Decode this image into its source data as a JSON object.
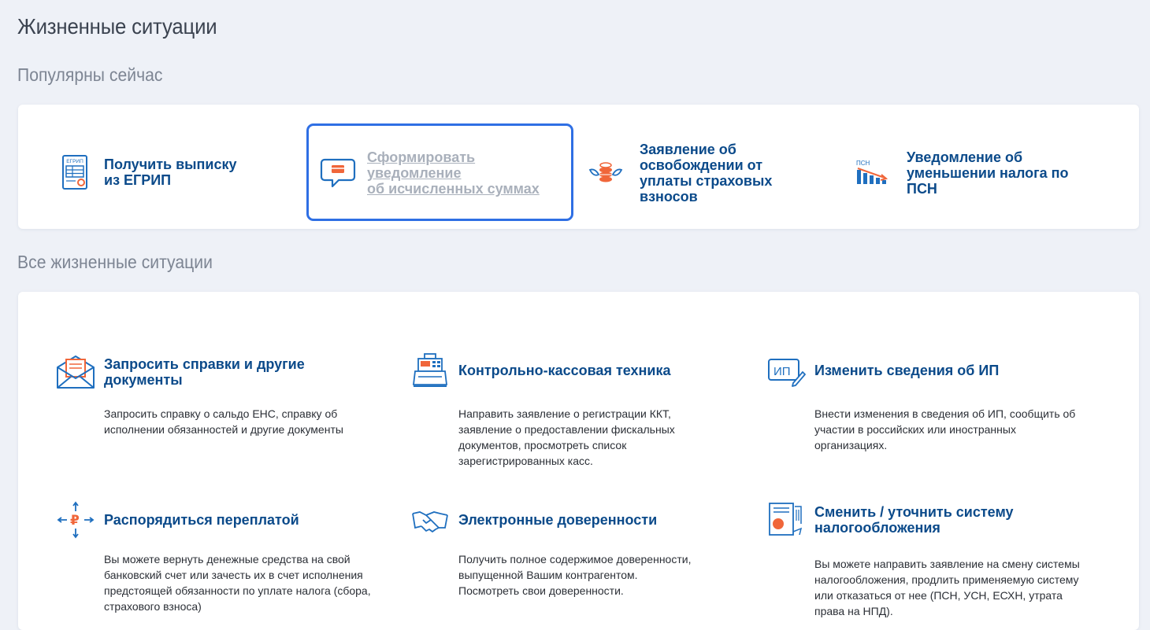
{
  "page": {
    "title": "Жизненные ситуации"
  },
  "sections": {
    "popular": "Популярны сейчас",
    "all": "Все жизненные ситуации"
  },
  "popular": [
    {
      "label": "Получить выписку\nиз ЕГРИП",
      "icon": "egrip-document-icon",
      "icon_text": "ЕГРИП"
    },
    {
      "label": "Сформировать\nуведомление\nоб исчисленных суммах",
      "icon": "chat-notification-icon"
    },
    {
      "label": "Заявление об\nосвобождении от\nуплаты страховых\nвзносов",
      "icon": "coins-wings-icon"
    },
    {
      "label": "Уведомление об\nуменьшении налога по\nПСН",
      "icon": "psn-chart-icon",
      "icon_text": "ПСН"
    }
  ],
  "situations": [
    {
      "title": "Запросить справки и другие\nдокументы",
      "desc": "Запросить справку о сальдо ЕНС, справку об\nисполнении обязанностей и другие документы",
      "icon": "envelope-document-icon"
    },
    {
      "title": "Контрольно-кассовая техника",
      "desc": "Направить заявление о регистрации ККТ,\nзаявление о предоставлении фискальных\nдокументов, просмотреть список\nзарегистрированных касс.",
      "icon": "cash-register-icon"
    },
    {
      "title": "Изменить сведения об ИП",
      "desc": "Внести изменения в сведения об ИП, сообщить об\nучастии в российских или иностранных\nорганизациях.",
      "icon": "ip-edit-icon",
      "icon_text": "ИП"
    },
    {
      "title": "Распорядиться переплатой",
      "desc": "Вы можете вернуть денежные средства на свой\nбанковский счет или зачесть их в счет исполнения\nпредстоящей обязанности по уплате налога (сбора,\nстрахового взноса)",
      "icon": "ruble-arrows-icon",
      "icon_text": "₽"
    },
    {
      "title": "Электронные доверенности",
      "desc": "Получить полное содержимое доверенности,\nвыпущенной Вашим контрагентом.\nПосмотреть свои доверенности.",
      "icon": "handshake-icon"
    },
    {
      "title": "Сменить / уточнить систему\nналогообложения",
      "desc": "Вы можете направить заявление на смену системы\nналогообложения, продлить применяемую систему\nили отказаться от нее (ПСН, УСН, ЕСХН, утрата\nправа на НПД).",
      "icon": "tax-system-document-icon"
    }
  ],
  "colors": {
    "accent": "#0b4a8a",
    "icon_blue": "#1f6fbf",
    "icon_orange": "#f0663a",
    "highlight": "#2f6fe4"
  }
}
